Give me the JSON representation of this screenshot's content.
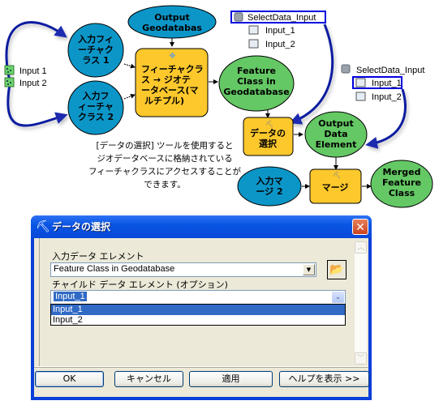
{
  "diagram": {
    "left_inputs": [
      {
        "label": "Input 1",
        "icon": "feature-dataset-icon"
      },
      {
        "label": "Input 2",
        "icon": "feature-dataset-icon"
      }
    ],
    "nodes": {
      "input_fc1": [
        "入力フィ",
        "ーチャク",
        "ラス 1"
      ],
      "input_fc2": [
        "入力フ",
        "ィーチャ",
        "クラス 2"
      ],
      "output_gdb": [
        "Output",
        "Geodatabas"
      ],
      "fc_to_gdb_tool": [
        "フィーチャクラ",
        "ス → ジオテ",
        "ータベース(マ",
        "ルチプル)"
      ],
      "feature_class_gdb": [
        "Feature",
        "Class in",
        "Geodatabase"
      ],
      "select_data_tool": [
        "データの",
        "選択"
      ],
      "output_data_element": [
        "Output",
        "Data",
        "Element"
      ],
      "input_merge2": [
        "入力マ",
        "ージ 2"
      ],
      "merge_tool": [
        "マージ"
      ],
      "merged_fc": [
        "Merged",
        "Feature",
        "Class"
      ]
    },
    "select_data_input_top": {
      "label": "SelectData_Input",
      "children": [
        "Input_1",
        "Input_2"
      ]
    },
    "select_data_input_right": {
      "label": "SelectData_Input",
      "children": [
        "Input_1",
        "Input_2"
      ],
      "highlighted_child": "Input_1"
    },
    "caption": [
      "[データの選択] ツールを使用すると",
      "ジオデータベースに格納されている",
      "フィーチャクラスにアクセスすることが",
      "できます。"
    ],
    "colors": {
      "input_blue": "#0c96c8",
      "tool_yellow": "#fcc82c",
      "output_green": "#64c864",
      "connector_blue": "#0a1ea0",
      "highlight_box": "#0000e0"
    }
  },
  "dialog": {
    "title": "データの選択",
    "close_label": "✕",
    "input_label": "入力データ エレメント",
    "input_value": "Feature Class in Geodatabase",
    "child_label": "チャイルド データ エレメント (オプション)",
    "child_value": "Input_1",
    "child_options": [
      "Input_1",
      "Input_2"
    ],
    "selected_option": "Input_1",
    "buttons": {
      "ok": "OK",
      "cancel": "キャンセル",
      "apply": "適用",
      "help": "ヘルプを表示 >>"
    }
  }
}
